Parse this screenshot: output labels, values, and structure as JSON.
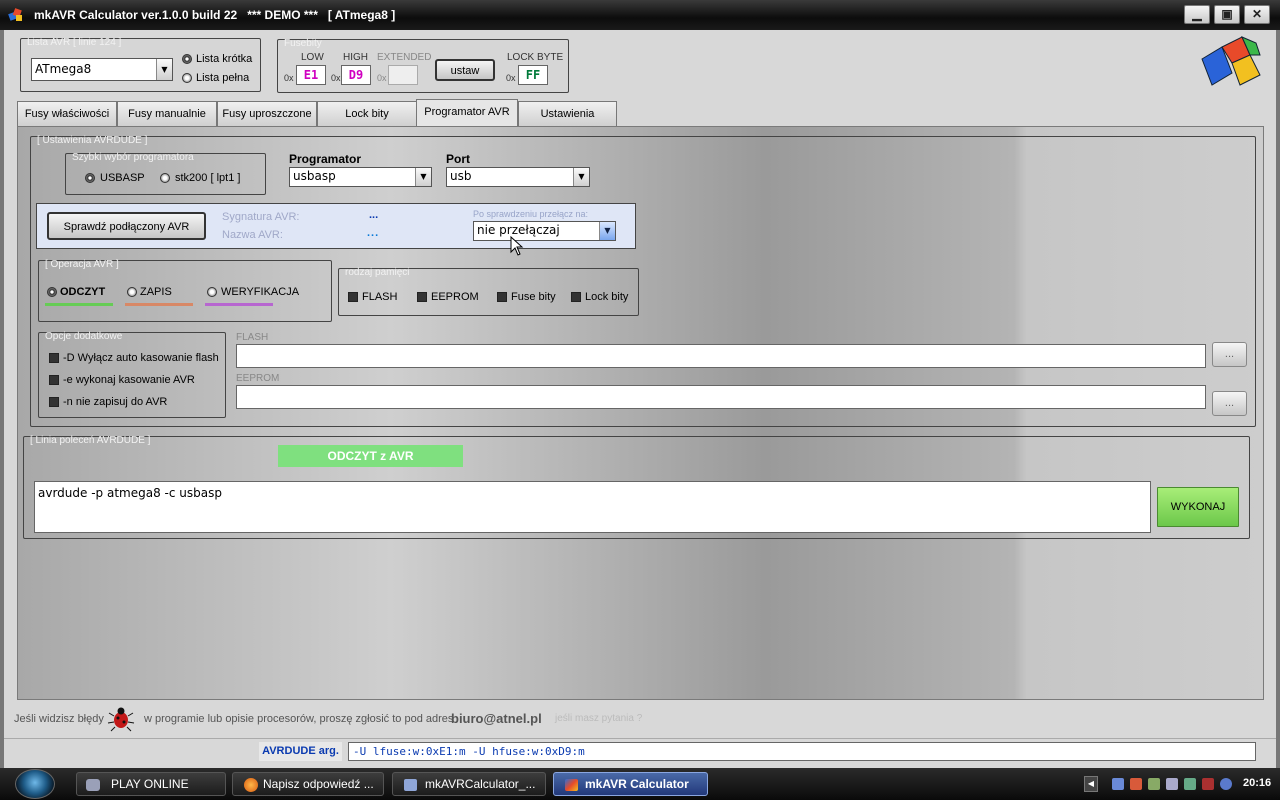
{
  "window": {
    "title": "mkAVR Calculator ver.1.0.0 build 22   *** DEMO ***   [ ATmega8 ]",
    "min": "▁",
    "max": "▣",
    "close": "✕"
  },
  "avr_list": {
    "group_title": "Lista AVR [ linie 124 ]",
    "selected": "ATmega8",
    "short_label": "Lista krótka",
    "full_label": "Lista pełna"
  },
  "fuses": {
    "group_title": "Fusebity",
    "low_label": "LOW",
    "high_label": "HIGH",
    "extended_label": "EXTENDED",
    "lock_label": "LOCK BYTE",
    "prefix": "0x",
    "low_value": "E1",
    "high_value": "D9",
    "extended_value": "",
    "lock_value": "FF",
    "set_button": "ustaw",
    "low_color": "#d000c0",
    "high_color": "#d000c0",
    "lock_color": "#007a3a"
  },
  "tabs": [
    {
      "label": "Fusy właściwości"
    },
    {
      "label": "Fusy manualnie"
    },
    {
      "label": "Fusy uproszczone"
    },
    {
      "label": "Lock bity"
    },
    {
      "label": "Programator AVR"
    },
    {
      "label": "Ustawienia"
    }
  ],
  "avrdude": {
    "group_title": "[ Ustawienia AVRDUDE ]",
    "quick_title": "Szybki wybór programatora",
    "quick_usbasp": "USBASP",
    "quick_stk200": "stk200 [ lpt1 ]",
    "programmer_label": "Programator",
    "programmer_value": "usbasp",
    "port_label": "Port",
    "port_value": "usb",
    "check_button": "Sprawdź podłączony AVR",
    "signature_label": "Sygnatura AVR:",
    "signature_value": "...",
    "name_label": "Nazwa AVR:",
    "name_value": "...",
    "switch_label": "Po sprawdzeniu przełącz na:",
    "switch_value": "nie przełączaj"
  },
  "operation": {
    "group_title": "[ Operacja AVR ]",
    "read": "ODCZYT",
    "write": "ZAPIS",
    "verify": "WERYFIKACJA",
    "read_color": "#66cc55",
    "write_color": "#d88866",
    "verify_color": "#b766d0"
  },
  "memory": {
    "group_title": "rodzaj pamięci",
    "flash": "FLASH",
    "eeprom": "EEPROM",
    "fuse": "Fuse bity",
    "lock": "Lock bity"
  },
  "options": {
    "group_title": "Opcje dodatkowe",
    "opt_d": "-D Wyłącz auto kasowanie flash",
    "opt_e": "-e wykonaj kasowanie AVR",
    "opt_n": "-n nie zapisuj do AVR"
  },
  "files": {
    "flash_label": "FLASH",
    "flash_value": "",
    "eeprom_label": "EEPROM",
    "eeprom_value": "",
    "browse": "..."
  },
  "command": {
    "group_title": "[ Linia poleceń AVRDUDE ]",
    "mode_banner": "ODCZYT z AVR",
    "text": "avrdude -p atmega8 -c usbasp",
    "run_button": "WYKONAJ",
    "banner_color": "#7fe07f"
  },
  "footer": {
    "bug_prefix": "Jeśli widzisz błędy",
    "bug_text": "w programie lub opisie procesorów, proszę zgłosić to pod adres",
    "email": "biuro@atnel.pl",
    "question": "jeśli masz pytania ?",
    "args_label": "AVRDUDE arg.",
    "args_value": "-U lfuse:w:0xE1:m  -U hfuse:w:0xD9:m"
  },
  "taskbar": {
    "items": [
      {
        "label": "PLAY ONLINE"
      },
      {
        "label": "Napisz odpowiedź ..."
      },
      {
        "label": "mkAVRCalculator_..."
      },
      {
        "label": "mkAVR Calculator"
      }
    ],
    "clock": "20:16"
  }
}
